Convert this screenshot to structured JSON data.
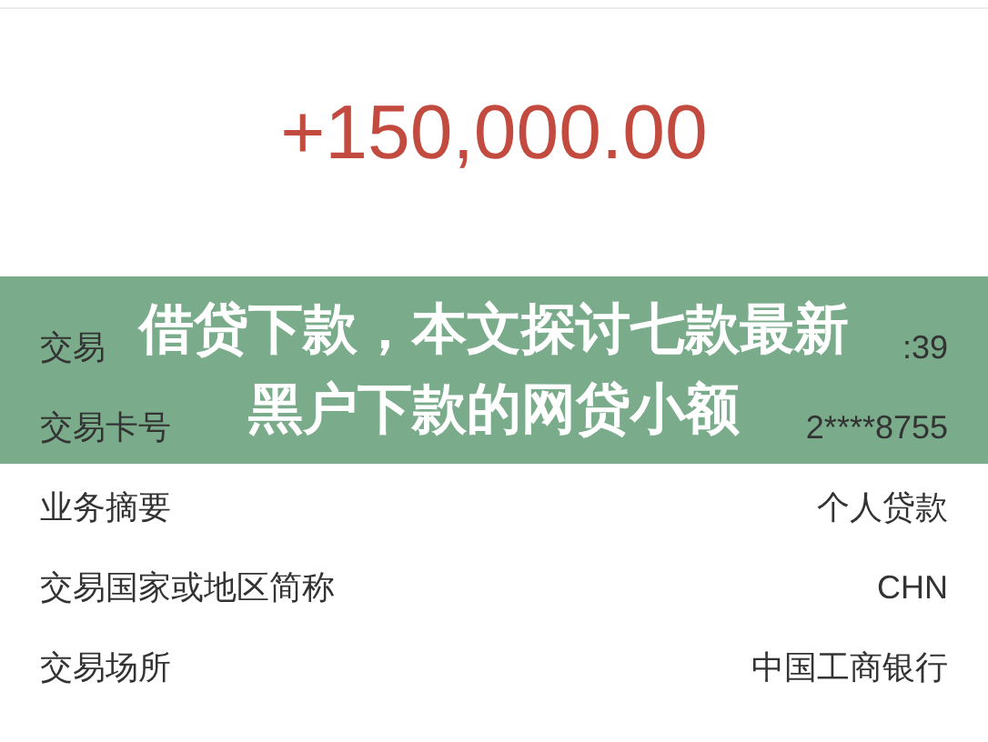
{
  "amount": "+150,000.00",
  "details": [
    {
      "label": "交易",
      "value": ":39"
    },
    {
      "label": "交易卡号",
      "value": "2****8755"
    },
    {
      "label": "业务摘要",
      "value": "个人贷款"
    },
    {
      "label": "交易国家或地区简称",
      "value": "CHN"
    },
    {
      "label": "交易场所",
      "value": "中国工商银行"
    }
  ],
  "banner": {
    "lines": [
      "借贷下款，本文探讨七款最新",
      "黑户下款的网贷小额"
    ]
  }
}
